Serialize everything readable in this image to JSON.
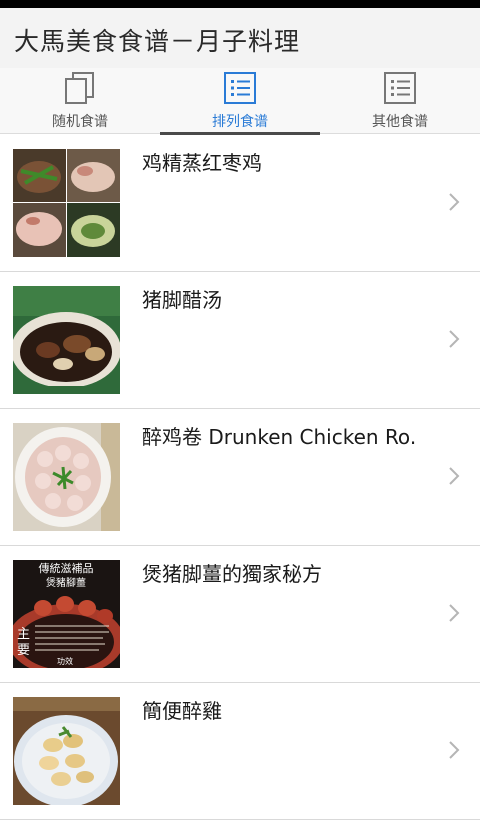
{
  "app": {
    "title": "大馬美食食谱－月子料理"
  },
  "tabs": [
    {
      "label": "随机食谱",
      "icon": "copy-pages-icon",
      "active": false
    },
    {
      "label": "排列食谱",
      "icon": "list-icon",
      "active": true
    },
    {
      "label": "其他食谱",
      "icon": "list-icon",
      "active": false
    }
  ],
  "colors": {
    "accent": "#2a7bd6",
    "tab_underline": "#4a4a4a",
    "divider": "#d9d9d9"
  },
  "recipes": [
    {
      "title": "鸡精蒸红枣鸡"
    },
    {
      "title": "猪脚醋汤"
    },
    {
      "title": "醉鸡卷 Drunken Chicken Ro."
    },
    {
      "title": "煲猪脚薑的獨家秘方",
      "thumb_text": [
        "傳統滋補品",
        "煲豬腳薑",
        "主",
        "要",
        "功效"
      ]
    },
    {
      "title": "簡便醉雞"
    }
  ]
}
